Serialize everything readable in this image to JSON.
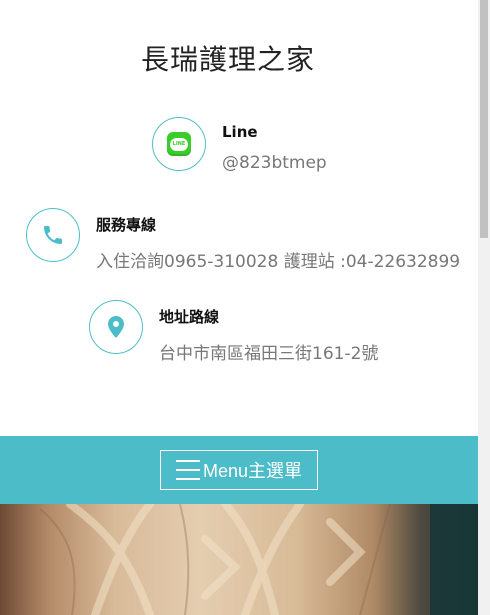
{
  "site": {
    "title": "長瑞護理之家"
  },
  "contacts": {
    "line": {
      "title": "Line",
      "value": "@823btmep",
      "icon": "line-logo-icon"
    },
    "phone": {
      "title": "服務專線",
      "value": "入住洽詢0965-310028 護理站 :04-22632899",
      "icon": "phone-icon"
    },
    "address": {
      "title": "地址路線",
      "value": "台中市南區福田三街161-2號",
      "icon": "map-pin-icon"
    }
  },
  "menu": {
    "label": "Menu主選單",
    "icon": "hamburger-icon"
  },
  "colors": {
    "accent": "#4bbcc8",
    "circle_border": "#4fbfc7",
    "line_green": "#3acd29"
  }
}
